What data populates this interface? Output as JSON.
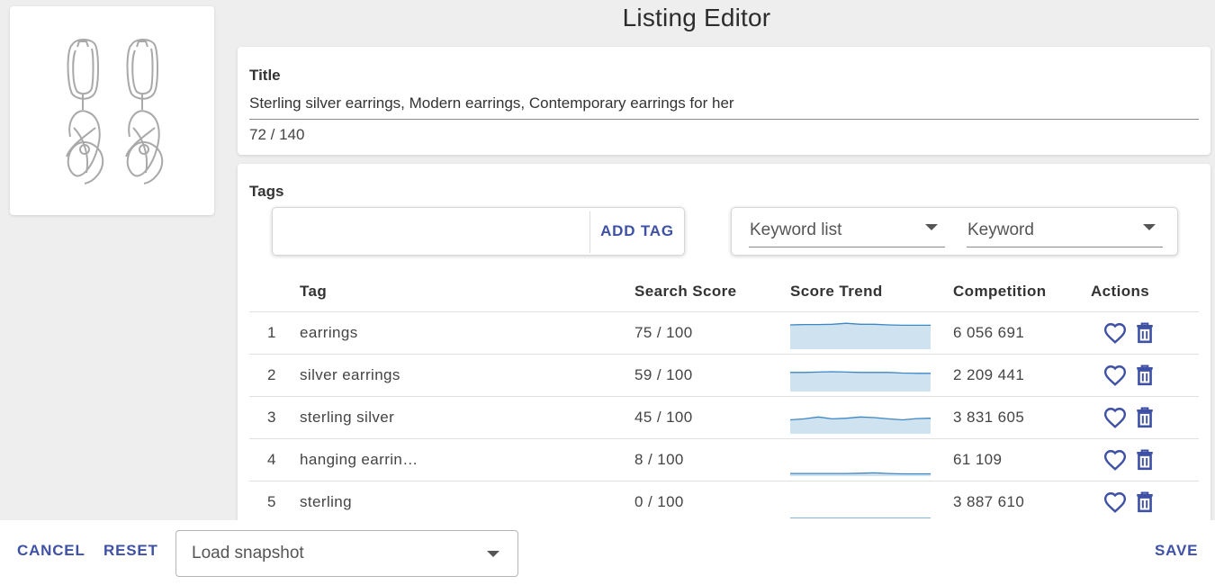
{
  "page": {
    "title": "Listing Editor"
  },
  "product_image": {
    "icon": "earrings-image"
  },
  "title_section": {
    "label": "Title",
    "value": "Sterling silver earrings, Modern earrings, Contemporary earrings for her",
    "counter": "72 / 140"
  },
  "tags_section": {
    "label": "Tags",
    "input_placeholder": "",
    "add_tag_label": "ADD TAG",
    "keyword_list_placeholder": "Keyword list",
    "keyword_placeholder": "Keyword",
    "columns": [
      "Tag",
      "Search Score",
      "Score Trend",
      "Competition",
      "Actions"
    ],
    "rows": [
      {
        "num": "1",
        "tag": "earrings",
        "score": "75 / 100",
        "trend": [
          0.75,
          0.76,
          0.76,
          0.77,
          0.8,
          0.77,
          0.77,
          0.75,
          0.74,
          0.74,
          0.74
        ],
        "competition": "6 056 691"
      },
      {
        "num": "2",
        "tag": "silver earrings",
        "score": "59 / 100",
        "trend": [
          0.59,
          0.59,
          0.6,
          0.61,
          0.6,
          0.59,
          0.59,
          0.59,
          0.57,
          0.56,
          0.56
        ],
        "competition": "2 209 441"
      },
      {
        "num": "3",
        "tag": "sterling silver",
        "score": "45 / 100",
        "trend": [
          0.43,
          0.46,
          0.52,
          0.46,
          0.48,
          0.52,
          0.5,
          0.46,
          0.43,
          0.47,
          0.48
        ],
        "competition": "3 831 605"
      },
      {
        "num": "4",
        "tag": "hanging earrin…",
        "score": "8 / 100",
        "trend": [
          0.08,
          0.08,
          0.08,
          0.08,
          0.08,
          0.09,
          0.1,
          0.08,
          0.07,
          0.07,
          0.07
        ],
        "competition": "61 109"
      },
      {
        "num": "5",
        "tag": "sterling",
        "score": "0 / 100",
        "trend": [
          0,
          0,
          0,
          0,
          0,
          0,
          0,
          0,
          0,
          0,
          0
        ],
        "competition": "3 887 610"
      }
    ]
  },
  "bottom_bar": {
    "cancel_label": "CANCEL",
    "reset_label": "RESET",
    "snapshot_placeholder": "Load snapshot",
    "save_label": "SAVE"
  },
  "colors": {
    "accent": "#3f51a5",
    "trend_fill": "#cfe2f0",
    "trend_line": "#3d87c4"
  }
}
